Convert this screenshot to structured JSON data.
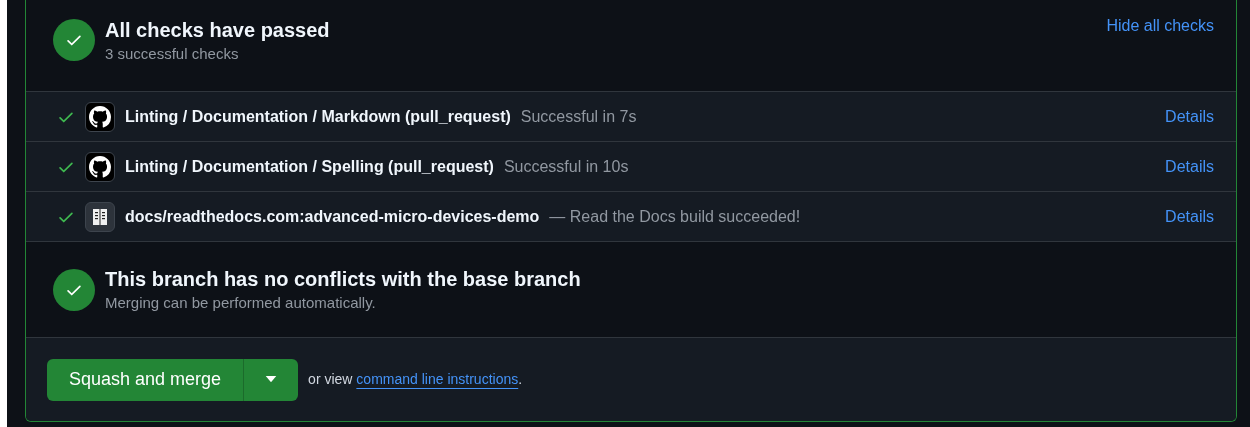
{
  "checks_summary": {
    "title": "All checks have passed",
    "subtitle": "3 successful checks",
    "toggle_link": "Hide all checks"
  },
  "checks": [
    {
      "kind": "github",
      "name": "Linting / Documentation / Markdown (pull_request)",
      "status": "Successful in 7s",
      "link": "Details"
    },
    {
      "kind": "github",
      "name": "Linting / Documentation / Spelling (pull_request)",
      "status": "Successful in 10s",
      "link": "Details"
    },
    {
      "kind": "docs",
      "name": "docs/readthedocs.com:advanced-micro-devices-demo",
      "status": "— Read the Docs build succeeded!",
      "link": "Details"
    }
  ],
  "merge_status": {
    "title": "This branch has no conflicts with the base branch",
    "subtitle": "Merging can be performed automatically."
  },
  "merge_box": {
    "button": "Squash and merge",
    "hint": "or view",
    "link": "command line instructions",
    "after_link": "."
  }
}
